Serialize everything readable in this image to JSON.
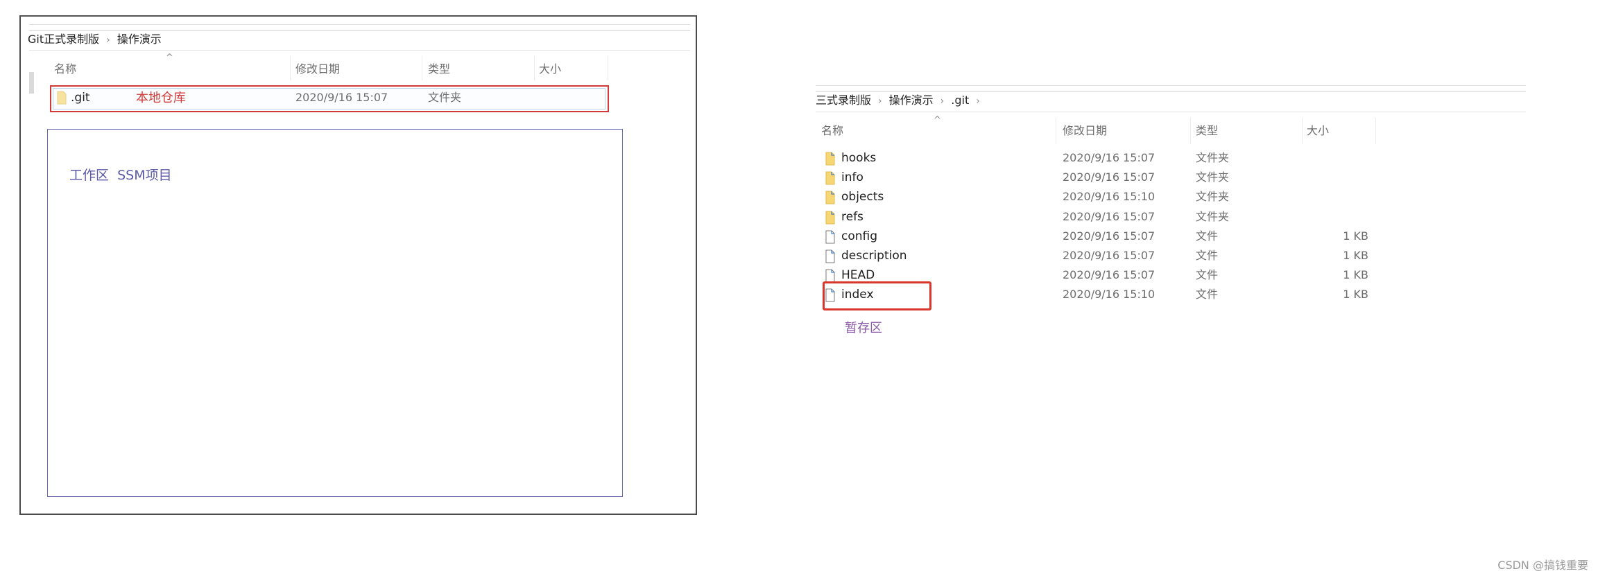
{
  "left_panel": {
    "breadcrumb": [
      "Git正式录制版",
      "操作演示"
    ],
    "breadcrumb_separator": "›",
    "sort_indicator": "^",
    "columns": [
      "名称",
      "修改日期",
      "类型",
      "大小"
    ],
    "rows": [
      {
        "name": ".git",
        "icon": "folder-icon",
        "modified": "2020/9/16 15:07",
        "type": "文件夹",
        "size": ""
      }
    ],
    "annotation_repo": "本地仓库",
    "annotation_workspace": "工作区  SSM项目",
    "colors": {
      "repo_annotation": "#d23a3a",
      "workspace_box": "#6a6ab0"
    }
  },
  "right_panel": {
    "breadcrumb": [
      "三式录制版",
      "操作演示",
      ".git"
    ],
    "breadcrumb_separator": "›",
    "sort_indicator": "^",
    "columns": [
      "名称",
      "修改日期",
      "类型",
      "大小"
    ],
    "rows": [
      {
        "name": "hooks",
        "icon": "folder-icon",
        "modified": "2020/9/16 15:07",
        "type": "文件夹",
        "size": ""
      },
      {
        "name": "info",
        "icon": "folder-icon",
        "modified": "2020/9/16 15:07",
        "type": "文件夹",
        "size": ""
      },
      {
        "name": "objects",
        "icon": "folder-icon",
        "modified": "2020/9/16 15:10",
        "type": "文件夹",
        "size": ""
      },
      {
        "name": "refs",
        "icon": "folder-icon",
        "modified": "2020/9/16 15:07",
        "type": "文件夹",
        "size": ""
      },
      {
        "name": "config",
        "icon": "file-icon",
        "modified": "2020/9/16 15:07",
        "type": "文件",
        "size": "1 KB"
      },
      {
        "name": "description",
        "icon": "file-icon",
        "modified": "2020/9/16 15:07",
        "type": "文件",
        "size": "1 KB"
      },
      {
        "name": "HEAD",
        "icon": "file-icon",
        "modified": "2020/9/16 15:07",
        "type": "文件",
        "size": "1 KB"
      },
      {
        "name": "index",
        "icon": "file-icon",
        "modified": "2020/9/16 15:10",
        "type": "文件",
        "size": "1 KB"
      }
    ],
    "annotation_staging": "暂存区",
    "colors": {
      "highlight_box": "#d9362b",
      "staging_annotation": "#8a5aa8"
    }
  },
  "watermark": "CSDN @搞钱重要"
}
